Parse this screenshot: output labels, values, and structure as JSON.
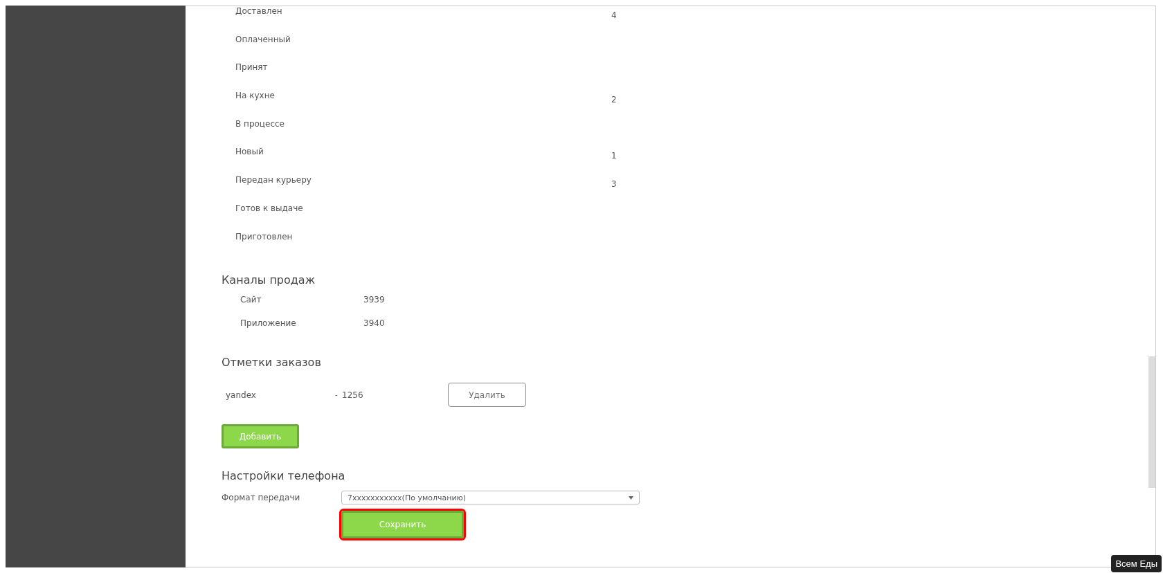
{
  "statuses": [
    {
      "label": "Доставлен",
      "count": "4"
    },
    {
      "label": "Оплаченный"
    },
    {
      "label": "Принят"
    },
    {
      "label": "На кухне",
      "count": "2"
    },
    {
      "label": "В процессе"
    },
    {
      "label": "Новый",
      "count": "1"
    },
    {
      "label": "Передан курьеру",
      "count": "3"
    },
    {
      "label": "Готов к выдаче"
    },
    {
      "label": "Приготовлен"
    }
  ],
  "sales_channels": {
    "title": "Каналы продаж",
    "items": [
      {
        "label": "Сайт",
        "value": "3939"
      },
      {
        "label": "Приложение",
        "value": "3940"
      }
    ]
  },
  "order_marks": {
    "title": "Отметки заказов",
    "rows": [
      {
        "name": "yandex",
        "separator": "-",
        "value": "1256",
        "delete_button": "Удалить"
      }
    ],
    "add_button": "Добавить"
  },
  "phone_settings": {
    "title": "Настройки телефона",
    "format_label": "Формат передачи",
    "format_value": "7xxxxxxxxxxx(По умолчанию)",
    "save_button": "Сохранить",
    "save_highlighted": true
  },
  "tooltip": "Всем Еды"
}
